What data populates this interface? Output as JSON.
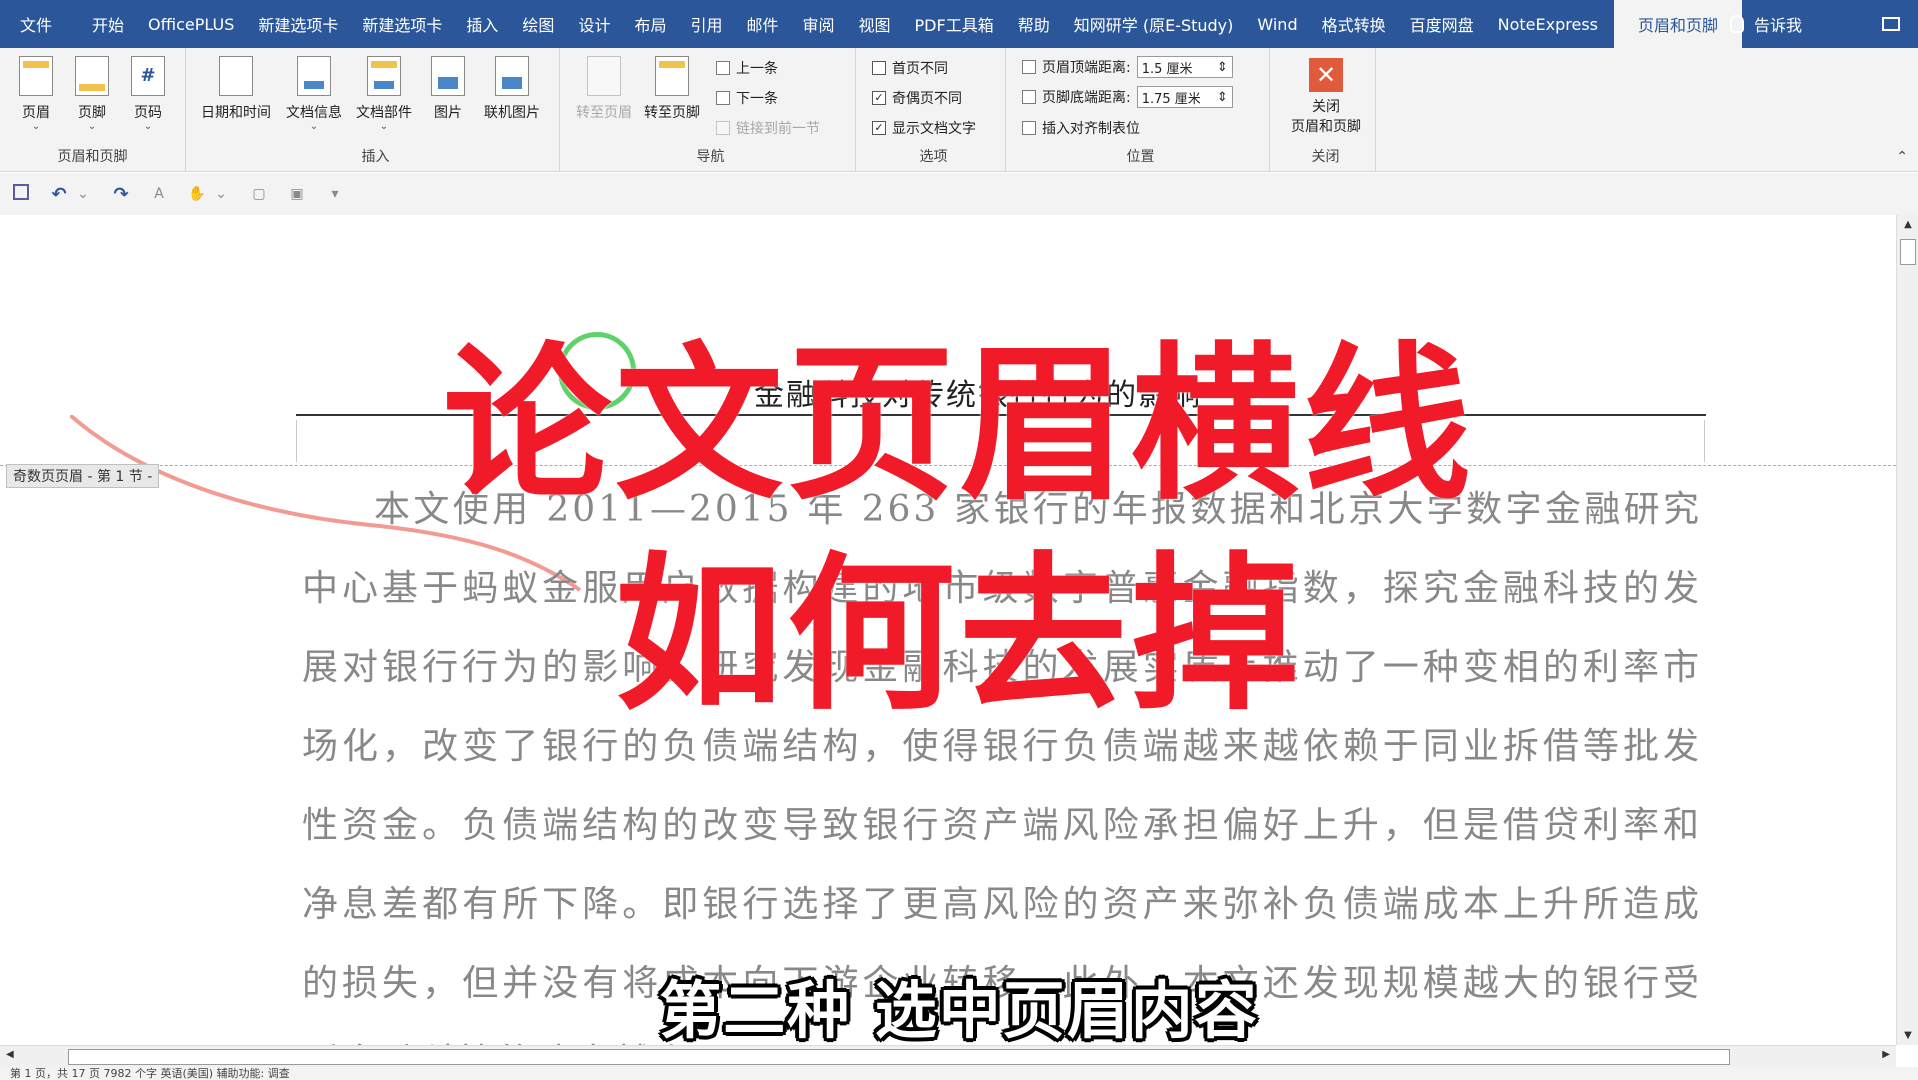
{
  "tabs": [
    "文件",
    "开始",
    "OfficePLUS",
    "新建选项卡",
    "新建选项卡",
    "插入",
    "绘图",
    "设计",
    "布局",
    "引用",
    "邮件",
    "审阅",
    "视图",
    "PDF工具箱",
    "帮助",
    "知网研学 (原E-Study)",
    "Wind",
    "格式转换",
    "百度网盘",
    "NoteExpress"
  ],
  "active_tab": "页眉和页脚",
  "tell_me": "告诉我",
  "ribbon": {
    "hf_group": {
      "label": "页眉和页脚",
      "header": "页眉",
      "footer": "页脚",
      "page_number": "页码"
    },
    "insert_group": {
      "label": "插入",
      "datetime": "日期和时间",
      "docinfo": "文档信息",
      "quickparts": "文档部件",
      "picture": "图片",
      "online_picture": "联机图片"
    },
    "nav_group": {
      "label": "导航",
      "goto_header": "转至页眉",
      "goto_footer": "转至页脚",
      "previous": "上一条",
      "next": "下一条",
      "link_previous": "链接到前一节"
    },
    "options_group": {
      "label": "选项",
      "different_first": "首页不同",
      "different_odd_even": "奇偶页不同",
      "show_doc_text": "显示文档文字"
    },
    "position_group": {
      "label": "位置",
      "header_from_top_label": "页眉顶端距离:",
      "header_from_top_value": "1.5 厘米",
      "footer_from_bottom_label": "页脚底端距离:",
      "footer_from_bottom_value": "1.75 厘米",
      "insert_align_tab": "插入对齐制表位"
    },
    "close_group": {
      "label": "关闭",
      "close_line1": "关闭",
      "close_line2": "页眉和页脚"
    }
  },
  "document": {
    "header_section_tag": "奇数页页眉 - 第 1 节 -",
    "header_text": "金融科技对传统银行行为的影响",
    "body_text": "本文使用 2011—2015 年 263 家银行的年报数据和北京大学数字金融研究中心基于蚂蚁金服用户数据构建的地市级数字普惠金融指数，探究金融科技的发展对银行行为的影响。研究发现金融科技的发展实质上推动了一种变相的利率市场化，改变了银行的负债端结构，使得银行负债端越来越依赖于同业拆借等批发性资金。负债端结构的改变导致银行资产端风险承担偏好上升，但是借贷利率和净息差都有所下降。即银行选择了更高风险的资产来弥补负债端成本上升所造成的损失，但并没有将成本向下游企业转移。此外，本文还发现规模越大的银行受到金融科技的冲击越小。"
  },
  "overlay": {
    "title_line1": "论文页眉横线",
    "title_line2": "如何去掉",
    "subtitle": "第二种 选中页眉内容"
  },
  "status": {
    "text": "第 1 页，共 17 页    7982 个字    英语(美国)    辅助功能: 调查"
  },
  "colors": {
    "title_bar": "#2b579a",
    "overlay_red": "#f01a28",
    "cursor_green": "#5fd16a",
    "close_red": "#e05a3c"
  }
}
